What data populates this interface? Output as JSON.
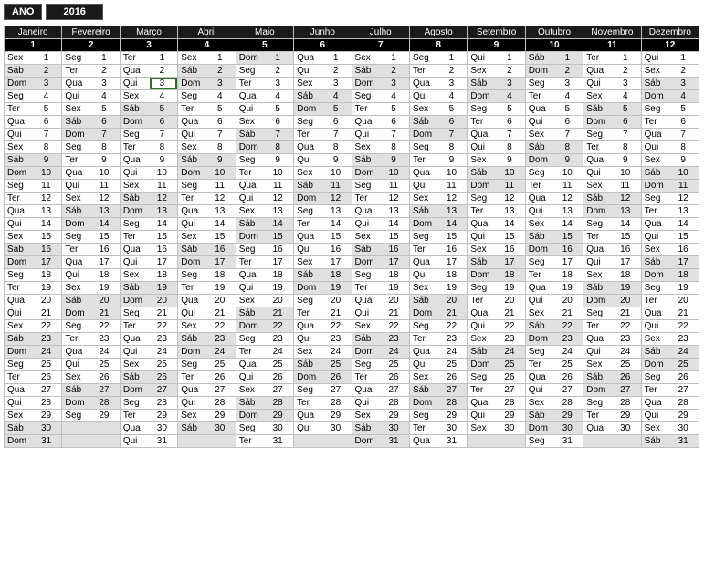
{
  "ano_label": "ANO",
  "year": "2016",
  "months": [
    {
      "name": "Janeiro",
      "num": "1"
    },
    {
      "name": "Fevereiro",
      "num": "2"
    },
    {
      "name": "Março",
      "num": "3"
    },
    {
      "name": "Abril",
      "num": "4"
    },
    {
      "name": "Maio",
      "num": "5"
    },
    {
      "name": "Junho",
      "num": "6"
    },
    {
      "name": "Julho",
      "num": "7"
    },
    {
      "name": "Agosto",
      "num": "8"
    },
    {
      "name": "Setembro",
      "num": "9"
    },
    {
      "name": "Outubro",
      "num": "10"
    },
    {
      "name": "Novembro",
      "num": "11"
    },
    {
      "name": "Dezembro",
      "num": "12"
    }
  ],
  "weekday_names": [
    "Dom",
    "Seg",
    "Ter",
    "Qua",
    "Qui",
    "Sex",
    "Sáb"
  ],
  "weekend_names": [
    "Sáb",
    "Dom"
  ],
  "month_start_wday": [
    5,
    1,
    2,
    5,
    0,
    3,
    5,
    1,
    4,
    6,
    2,
    4
  ],
  "month_lengths": [
    31,
    29,
    31,
    30,
    31,
    30,
    31,
    31,
    30,
    31,
    30,
    31
  ],
  "selected": {
    "month": 2,
    "day": 3
  }
}
